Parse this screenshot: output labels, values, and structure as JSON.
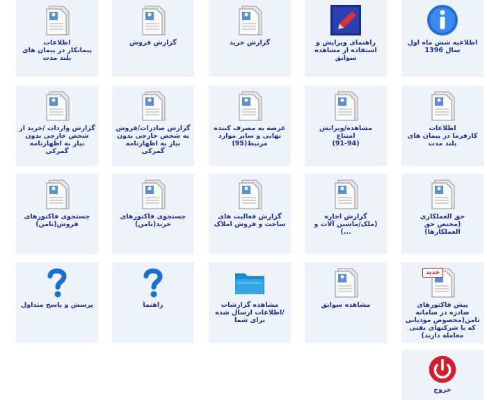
{
  "tiles": [
    {
      "key": "info-6month",
      "icon": "info-icon",
      "label": "اطلاعیه شش ماه اول\nسال 1396"
    },
    {
      "key": "guide-edit",
      "icon": "edit-pencil-icon",
      "label": "راهنمای ویرایش و\nاستفاده از مشاهده\nسوابق"
    },
    {
      "key": "buy-report",
      "icon": "document-icon",
      "label": "گزارش خرید"
    },
    {
      "key": "sale-report",
      "icon": "document-icon",
      "label": "گزارش فروش"
    },
    {
      "key": "contractor-info",
      "icon": "document-icon",
      "label": "اطلاعات\nپیمانکار در پیمان های\nبلند مدت"
    },
    {
      "key": "employer-info",
      "icon": "document-icon",
      "label": "اطلاعات\nکارفرما در پیمان های\nبلند مدت"
    },
    {
      "key": "view-edit-refuse",
      "icon": "document-icon",
      "label": "مشاهده/ویرایش\nامتناع\n(91-94)"
    },
    {
      "key": "final-consumer",
      "icon": "document-icon",
      "label": "عرضه به مصرف کننده\nنهایی و سایر موارد\nمرتبط(95)"
    },
    {
      "key": "export-report",
      "icon": "document-icon",
      "label": "گزارش صادرات/فروش\nبه شخص خارجی بدون\nنیاز به اظهارنامه\nگمرکی"
    },
    {
      "key": "import-report",
      "icon": "document-icon",
      "label": "گزارش واردات /خرید از\nشخص خارجی بدون\nنیاز به اظهارنامه\nگمرکی"
    },
    {
      "key": "fee-report",
      "icon": "document-icon",
      "label": "حق العملکاری\n(مختص حق\nالعملکارها)"
    },
    {
      "key": "rent-report",
      "icon": "document-icon",
      "label": "گزارش اجاره\n(ملک/ماشین آلات و\n...)"
    },
    {
      "key": "construction-report",
      "icon": "document-icon",
      "label": "گزارش فعالیت های\nساخت و فروش املاک"
    },
    {
      "key": "buy-invoice-search",
      "icon": "document-icon",
      "label": "جستجوی فاکتورهای\nخرید(تامن)"
    },
    {
      "key": "sale-invoice-search",
      "icon": "document-icon",
      "label": "جستجوی فاکتورهای\nفروش(تامن)"
    },
    {
      "key": "invoice-preview",
      "icon": "new-document-icon",
      "badge": "جدید",
      "label": "پیش فاکتورهای\nصادره در سامانه\nتامن(مخصوص موديانی\nکه با شرکتهای نفتی\nمعامله دارند)"
    },
    {
      "key": "view-history",
      "icon": "document-icon",
      "label": "مشاهده سوابق"
    },
    {
      "key": "view-reports",
      "icon": "folder-icon",
      "label": "مشاهده گزارشات\n/اطلاعات ارسال شده\nبرای شما"
    },
    {
      "key": "help",
      "icon": "question-icon",
      "label": "راهنما"
    },
    {
      "key": "faq",
      "icon": "question-icon",
      "label": "پرسش و پاسخ متداول"
    },
    {
      "key": "exit",
      "icon": "power-icon",
      "label": "خروج"
    }
  ]
}
